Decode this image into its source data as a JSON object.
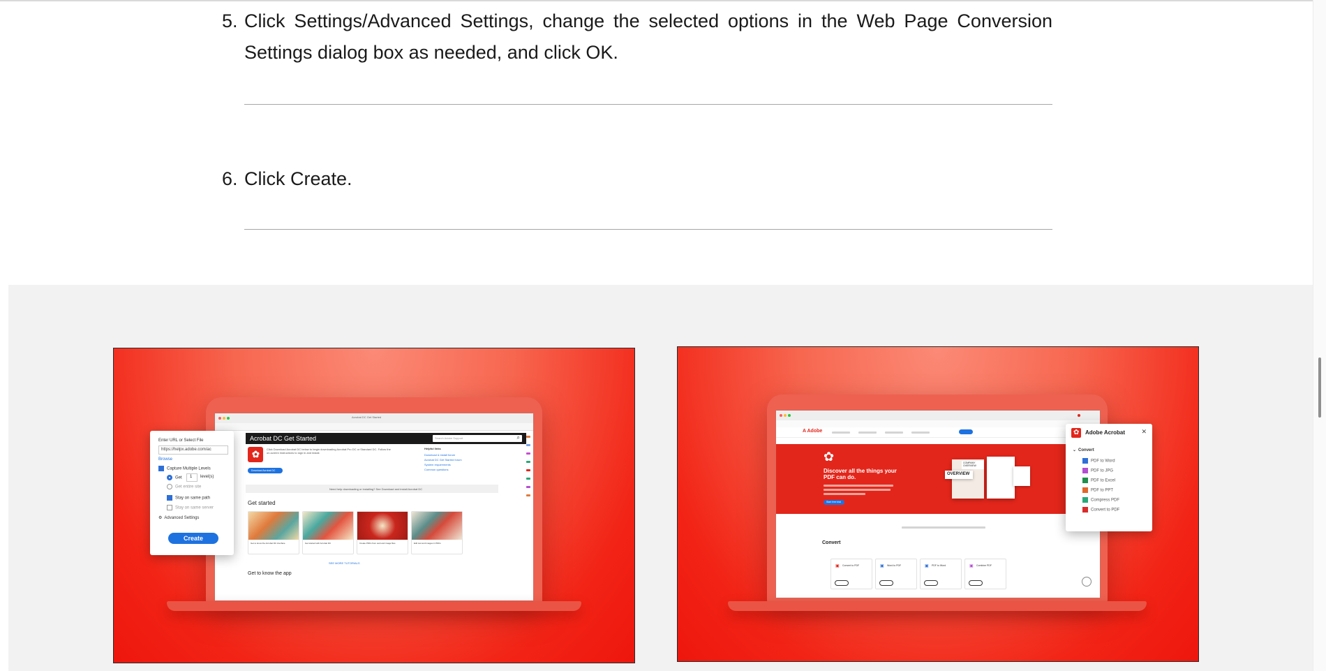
{
  "steps": [
    {
      "number": "5.",
      "text": "Click Settings/Advanced Settings, change the selected options in the Web Page Conversion Settings dialog box as needed, and click OK."
    },
    {
      "number": "6.",
      "text": "Click Create."
    }
  ],
  "gallery": {
    "left_image": {
      "window_title": "Acrobat DC Get Started",
      "header": "Acrobat DC Get Started",
      "search_placeholder": "Search Adobe Support",
      "intro_text": "Click Download Acrobat DC below to begin downloading Acrobat Pro DC or Standard DC. Follow the on-screen instructions to sign in and install.",
      "download_button": "Download Acrobat DC",
      "helpful_links_title": "Helpful links",
      "helpful_links": [
        "Download & install forum",
        "Acrobat DC Get Started forum",
        "System requirements",
        "Common questions"
      ],
      "help_strip": "Need help downloading or installing? See Download and install Acrobat DC",
      "get_started": "Get started",
      "tutorials": [
        "Get to know the Acrobat DC interface",
        "Get started with Acrobat DC",
        "Create PDFs from web and image files",
        "Edit text and images in PDFs"
      ],
      "see_more": "SEE MORE TUTORIALS",
      "get_to_know": "Get to know the app",
      "dialog": {
        "title": "Enter URL or Select File",
        "url_value": "https://helpx.adobe.com/ac",
        "browse": "Browse",
        "capture_multiple": "Capture Multiple Levels",
        "get_label": "Get",
        "get_value": "1",
        "levels": "level(s)",
        "get_entire_site": "Get entire site",
        "stay_same_path": "Stay on same path",
        "stay_same_server": "Stay on same server",
        "advanced_settings": "Advanced Settings",
        "create_button": "Create"
      }
    },
    "right_image": {
      "brand": "Adobe",
      "hero_title": "Discover all the things your PDF can do.",
      "hero_button": "Start free trial",
      "overview_badge": "OVERVIEW",
      "company_badge": "COMPANY OVERVIEW",
      "section_title": "Convert",
      "tools": [
        "Convert to PDF",
        "Word to PDF",
        "PDF to Word",
        "Combine PDF"
      ],
      "panel_title": "Adobe Acrobat",
      "panel_close": "✕",
      "panel_section": "Convert",
      "panel_items": [
        "PDF to Word",
        "PDF to JPG",
        "PDF to Excel",
        "PDF to PPT",
        "Compress PDF",
        "Convert to PDF"
      ],
      "panel_icon_colors": [
        "#2f6fd6",
        "#b34fd1",
        "#1f8f4a",
        "#e0672a",
        "#2aa87a",
        "#d92b2b"
      ]
    }
  },
  "colors": {
    "acrobat_red": "#e3261b",
    "blue": "#1e72e0"
  }
}
